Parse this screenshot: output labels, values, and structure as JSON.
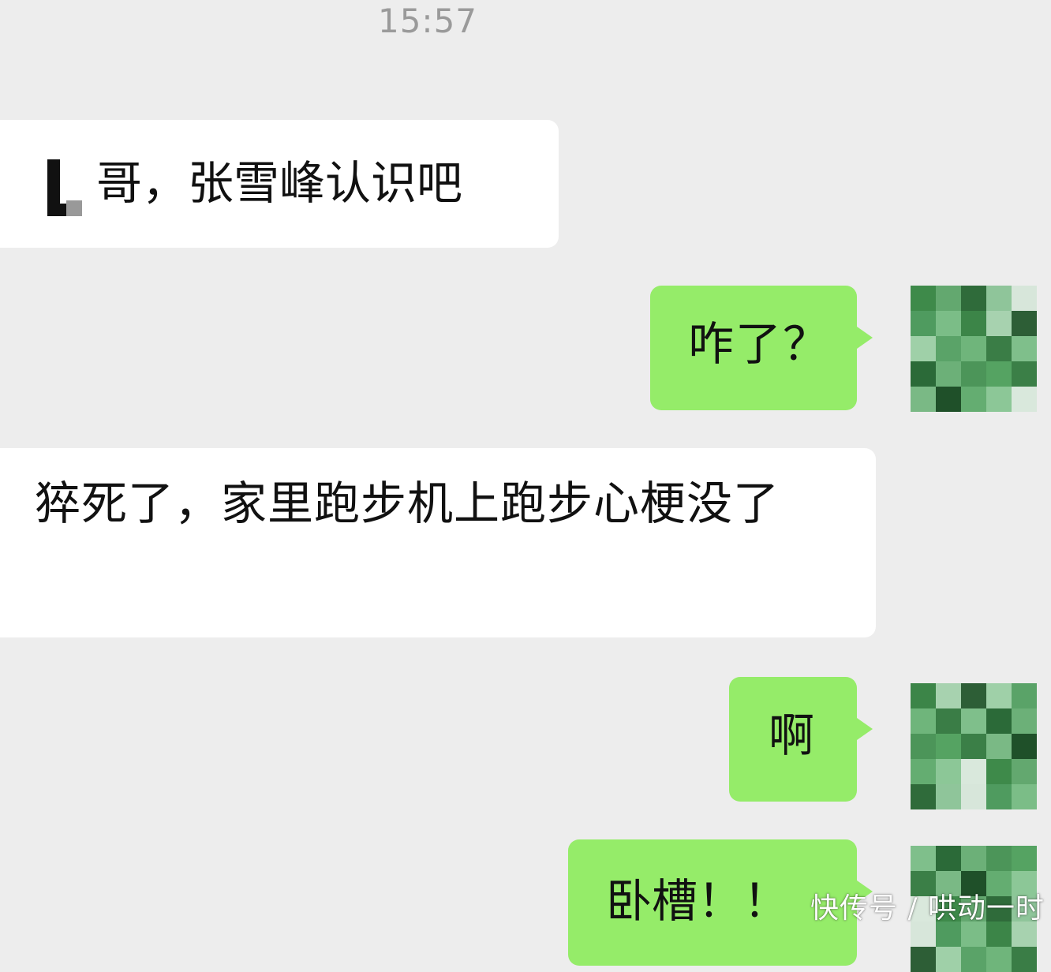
{
  "chat": {
    "timestamp": "15:57",
    "messages": [
      {
        "side": "incoming",
        "text": "哥，张雪峰认识吧"
      },
      {
        "side": "outgoing",
        "text": "咋了？"
      },
      {
        "side": "incoming",
        "text": "猝死了，家里跑步机上跑步心梗没了"
      },
      {
        "side": "outgoing",
        "text": "啊"
      },
      {
        "side": "outgoing",
        "text": "卧槽！！"
      }
    ]
  },
  "avatar": {
    "pixel_colors": [
      "#3e8a4a",
      "#63a86f",
      "#2f6b3a",
      "#8fc59a",
      "#d7e6da",
      "#4f9b5f",
      "#7bbd87",
      "#3c8548",
      "#a7d2af",
      "#2d5e36",
      "#9fd0a8",
      "#5aa368",
      "#6fb57b",
      "#3a7d46",
      "#7fbf8b",
      "#2b6a38",
      "#6cb078",
      "#4c9559",
      "#55a362",
      "#3b7f47",
      "#7ab985",
      "#1f5029",
      "#64ad71",
      "#8cc797",
      "#d9e8dc"
    ]
  },
  "watermark": {
    "text": "快传号 / 哄动一时"
  }
}
